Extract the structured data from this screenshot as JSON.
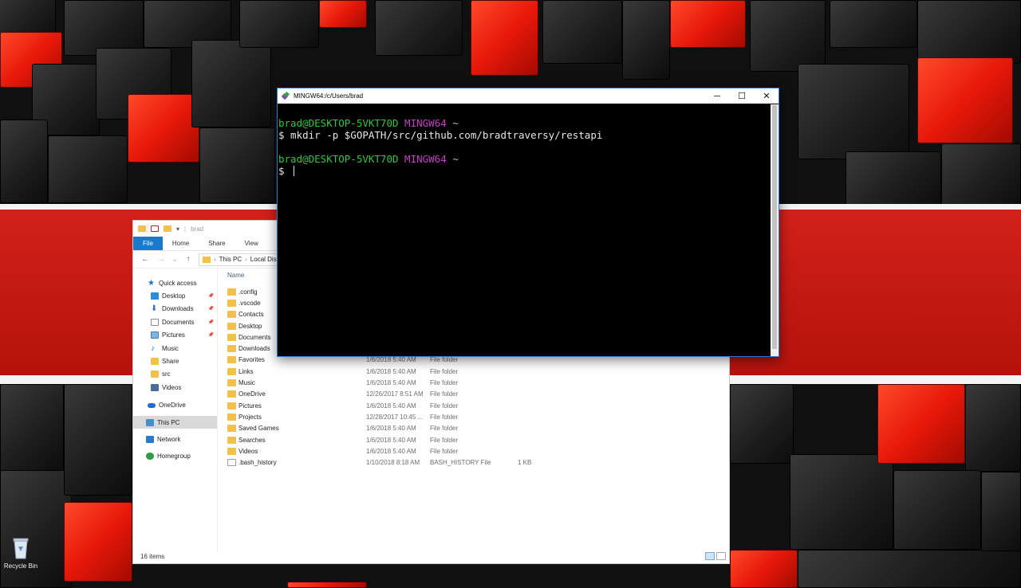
{
  "desktop": {
    "recycle_bin_label": "Recycle Bin"
  },
  "terminal": {
    "title": "MINGW64:/c/Users/brad",
    "lines": [
      {
        "user": "brad@DESKTOP-5VKT70D",
        "env": "MINGW64",
        "path": "~"
      },
      {
        "command": "$ mkdir -p $GOPATH/src/github.com/bradtraversy/restapi"
      },
      {
        "user": "brad@DESKTOP-5VKT70D",
        "env": "MINGW64",
        "path": "~"
      },
      {
        "command": "$ "
      }
    ],
    "colors": {
      "user": "#31c542",
      "env": "#c53ec5",
      "path": "#c8c34a",
      "text": "#e6e6e6",
      "background": "#000000"
    }
  },
  "explorer": {
    "title": "brad",
    "ribbon": [
      "File",
      "Home",
      "Share",
      "View"
    ],
    "breadcrumb": [
      "This PC",
      "Local Disk (C"
    ],
    "nav": [
      {
        "label": "Quick access",
        "icon": "star-icon",
        "pinned": false
      },
      {
        "label": "Desktop",
        "icon": "desktop-icon",
        "pinned": true
      },
      {
        "label": "Downloads",
        "icon": "download-icon",
        "pinned": true
      },
      {
        "label": "Documents",
        "icon": "document-icon",
        "pinned": true
      },
      {
        "label": "Pictures",
        "icon": "pictures-icon",
        "pinned": true
      },
      {
        "label": "Music",
        "icon": "music-icon",
        "pinned": false
      },
      {
        "label": "Share",
        "icon": "folder-icon",
        "pinned": false
      },
      {
        "label": "src",
        "icon": "folder-icon",
        "pinned": false
      },
      {
        "label": "Videos",
        "icon": "videos-icon",
        "pinned": false
      },
      {
        "label": "OneDrive",
        "icon": "onedrive-icon",
        "pinned": false
      },
      {
        "label": "This PC",
        "icon": "pc-icon",
        "pinned": false,
        "selected": true
      },
      {
        "label": "Network",
        "icon": "network-icon",
        "pinned": false
      },
      {
        "label": "Homegroup",
        "icon": "homegroup-icon",
        "pinned": false
      }
    ],
    "column_name": "Name",
    "files": [
      {
        "name": ".config",
        "date": "",
        "type": "",
        "size": ""
      },
      {
        "name": ".vscode",
        "date": "",
        "type": "",
        "size": ""
      },
      {
        "name": "Contacts",
        "date": "",
        "type": "",
        "size": ""
      },
      {
        "name": "Desktop",
        "date": "",
        "type": "",
        "size": ""
      },
      {
        "name": "Documents",
        "date": "",
        "type": "",
        "size": ""
      },
      {
        "name": "Downloads",
        "date": "",
        "type": "",
        "size": ""
      },
      {
        "name": "Favorites",
        "date": "1/6/2018 5:40 AM",
        "type": "File folder",
        "size": ""
      },
      {
        "name": "Links",
        "date": "1/6/2018 5:40 AM",
        "type": "File folder",
        "size": ""
      },
      {
        "name": "Music",
        "date": "1/6/2018 5:40 AM",
        "type": "File folder",
        "size": ""
      },
      {
        "name": "OneDrive",
        "date": "12/26/2017 8:51 AM",
        "type": "File folder",
        "size": ""
      },
      {
        "name": "Pictures",
        "date": "1/6/2018 5:40 AM",
        "type": "File folder",
        "size": ""
      },
      {
        "name": "Projects",
        "date": "12/28/2017 10:45 ...",
        "type": "File folder",
        "size": ""
      },
      {
        "name": "Saved Games",
        "date": "1/6/2018 5:40 AM",
        "type": "File folder",
        "size": ""
      },
      {
        "name": "Searches",
        "date": "1/6/2018 5:40 AM",
        "type": "File folder",
        "size": ""
      },
      {
        "name": "Videos",
        "date": "1/6/2018 5:40 AM",
        "type": "File folder",
        "size": ""
      },
      {
        "name": ".bash_history",
        "date": "1/10/2018 8:18 AM",
        "type": "BASH_HISTORY File",
        "size": "1 KB"
      }
    ],
    "status": "16 items"
  }
}
